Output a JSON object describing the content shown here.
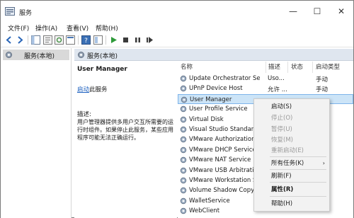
{
  "window": {
    "title": "服务",
    "caption_buttons": [
      "—",
      "☐",
      "✕"
    ]
  },
  "menubar": [
    "文件(F)",
    "操作(A)",
    "查看(V)",
    "帮助(H)"
  ],
  "toolbar_icons": [
    "back-icon",
    "forward-icon",
    "console-tree-icon",
    "properties-icon",
    "refresh-icon",
    "export-icon",
    "help-icon",
    "view-icon",
    "play-icon",
    "stop-icon",
    "pause-icon",
    "restart-icon"
  ],
  "tree": {
    "item": "服务(本地)"
  },
  "pane_header": "服务(本地)",
  "details": {
    "title": "User Manager",
    "action_link": "启动",
    "action_suffix": "此服务",
    "desc_label": "描述:",
    "desc_body": "用户管理器提供多用户交互所需要的运行时组件。如果停止此服务，某些应用程序可能无法正确运行。"
  },
  "columns": [
    "名称",
    "描述",
    "状态",
    "启动类型"
  ],
  "services": [
    {
      "name": "Update Orchestrator Ser...",
      "desc": "Uso...",
      "status": "",
      "startup": "手动"
    },
    {
      "name": "UPnP Device Host",
      "desc": "允许 ...",
      "status": "",
      "startup": "手动"
    },
    {
      "name": "User Manager",
      "desc": "",
      "status": "",
      "startup": ""
    },
    {
      "name": "User Profile Service",
      "desc": "",
      "status": "",
      "startup": ""
    },
    {
      "name": "Virtual Disk",
      "desc": "",
      "status": "",
      "startup": ""
    },
    {
      "name": "Visual Studio Standard",
      "desc": "",
      "status": "",
      "startup": ""
    },
    {
      "name": "VMware Authorization",
      "desc": "",
      "status": "",
      "startup": ""
    },
    {
      "name": "VMware DHCP Service",
      "desc": "",
      "status": "",
      "startup": ""
    },
    {
      "name": "VMware NAT Service",
      "desc": "",
      "status": "",
      "startup": ""
    },
    {
      "name": "VMware USB Arbitratic",
      "desc": "",
      "status": "",
      "startup": ""
    },
    {
      "name": "VMware Workstation S",
      "desc": "",
      "status": "",
      "startup": ""
    },
    {
      "name": "Volume Shadow Copy",
      "desc": "",
      "status": "",
      "startup": ""
    },
    {
      "name": "WalletService",
      "desc": "",
      "status": "",
      "startup": ""
    },
    {
      "name": "WebClient",
      "desc": "",
      "status": "",
      "startup": ""
    }
  ],
  "context_menu": [
    {
      "label": "启动(S)",
      "disabled": false
    },
    {
      "label": "停止(O)",
      "disabled": true
    },
    {
      "label": "暂停(U)",
      "disabled": true
    },
    {
      "label": "恢复(M)",
      "disabled": true
    },
    {
      "label": "重新启动(E)",
      "disabled": true
    },
    {
      "label": "所有任务(K)",
      "disabled": false,
      "submenu": true
    },
    {
      "label": "刷新(F)",
      "disabled": false
    },
    {
      "label": "属性(R)",
      "disabled": false,
      "bold": true
    },
    {
      "label": "帮助(H)",
      "disabled": false
    }
  ],
  "colors": {
    "selection": "#cce4f7",
    "header_band": "#dfe6ef",
    "link": "#1b5fbf"
  }
}
